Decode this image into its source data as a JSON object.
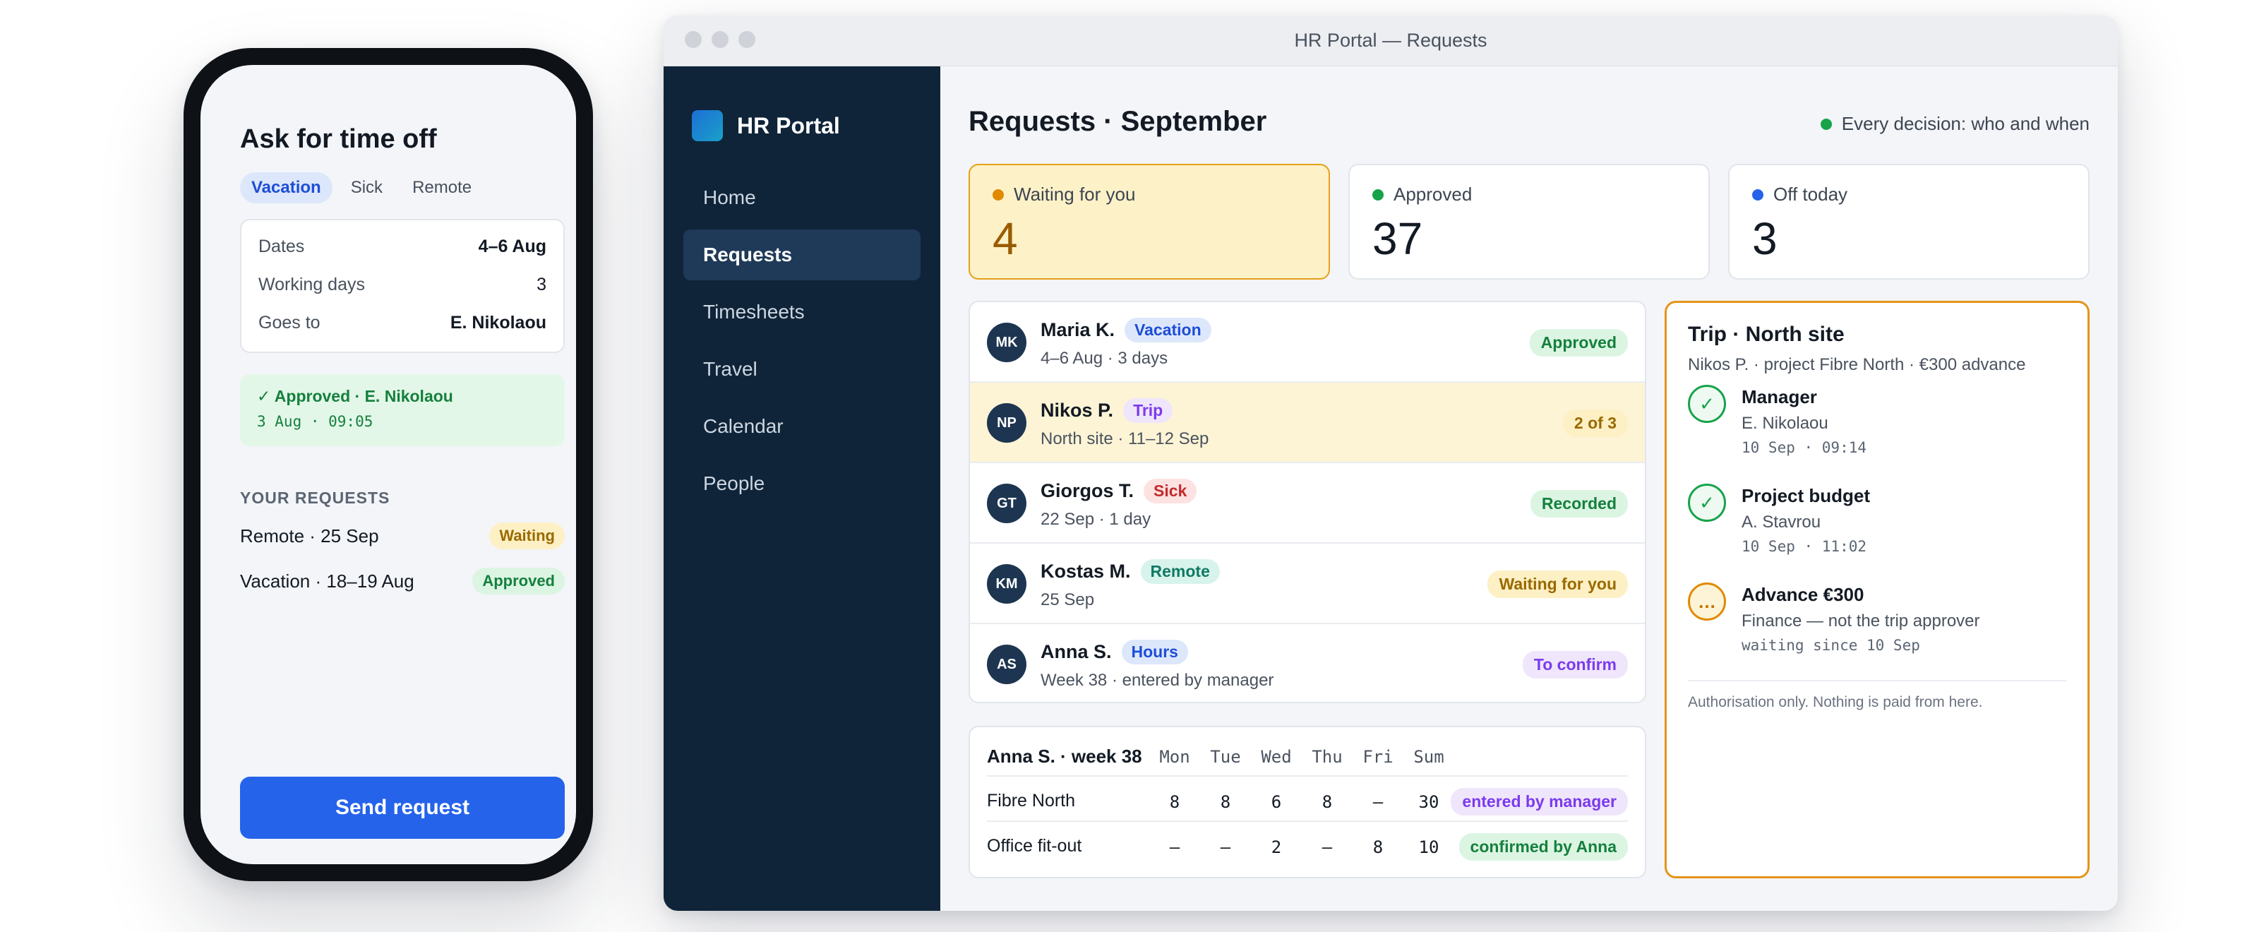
{
  "phone": {
    "title": "Ask for time off",
    "tabs": [
      {
        "label": "Vacation",
        "active": true
      },
      {
        "label": "Sick",
        "active": false
      },
      {
        "label": "Remote",
        "active": false
      }
    ],
    "form": {
      "dates_label": "Dates",
      "dates_value": "4–6 Aug",
      "days_label": "Working days",
      "days_value": "3",
      "goes_label": "Goes to",
      "goes_value": "E. Nikolaou"
    },
    "approval": {
      "line1": "✓ Approved · E. Nikolaou",
      "line2": "3 Aug · 09:05"
    },
    "section_title": "YOUR REQUESTS",
    "requests": [
      {
        "label": "Remote · 25 Sep",
        "status": "Waiting"
      },
      {
        "label": "Vacation · 18–19 Aug",
        "status": "Approved"
      }
    ],
    "send_label": "Send request"
  },
  "window": {
    "title": "HR Portal — Requests",
    "brand": "HR Portal",
    "nav": [
      {
        "label": "Home",
        "active": false
      },
      {
        "label": "Requests",
        "active": true
      },
      {
        "label": "Timesheets",
        "active": false
      },
      {
        "label": "Travel",
        "active": false
      },
      {
        "label": "Calendar",
        "active": false
      },
      {
        "label": "People",
        "active": false
      }
    ],
    "page_title": "Requests · September",
    "audit_note": "Every decision: who and when",
    "stats": [
      {
        "label": "Waiting for you",
        "value": "4",
        "color": "#e08a00"
      },
      {
        "label": "Approved",
        "value": "37",
        "color": "#16a34a"
      },
      {
        "label": "Off today",
        "value": "3",
        "color": "#2563eb"
      }
    ],
    "requests": [
      {
        "initials": "MK",
        "name": "Maria K.",
        "type": "Vacation",
        "sub": "4–6 Aug · 3 days",
        "status": "Approved"
      },
      {
        "initials": "NP",
        "name": "Nikos P.",
        "type": "Trip",
        "sub": "North site · 11–12 Sep",
        "status": "2 of 3"
      },
      {
        "initials": "GT",
        "name": "Giorgos T.",
        "type": "Sick",
        "sub": "22 Sep · 1 day",
        "status": "Recorded"
      },
      {
        "initials": "KM",
        "name": "Kostas M.",
        "type": "Remote",
        "sub": "25 Sep",
        "status": "Waiting for you"
      },
      {
        "initials": "AS",
        "name": "Anna S.",
        "type": "Hours",
        "sub": "Week 38 · entered by manager",
        "status": "To confirm"
      }
    ],
    "timesheet": {
      "title": "Anna S. · week 38",
      "days": [
        "Mon",
        "Tue",
        "Wed",
        "Thu",
        "Fri",
        "Sum"
      ],
      "rows": [
        {
          "project": "Fibre North",
          "hours": [
            "8",
            "8",
            "6",
            "8",
            "–",
            "30"
          ],
          "note": "entered by manager"
        },
        {
          "project": "Office fit-out",
          "hours": [
            "–",
            "–",
            "2",
            "–",
            "8",
            "10"
          ],
          "note": "confirmed by Anna"
        }
      ]
    },
    "detail": {
      "title": "Trip · North site",
      "subtitle": "Nikos P. · project Fibre North · €300 advance",
      "steps": [
        {
          "icon": "✓",
          "role": "Manager",
          "who": "E. Nikolaou",
          "when": "10 Sep · 09:14"
        },
        {
          "icon": "✓",
          "role": "Project budget",
          "who": "A. Stavrou",
          "when": "10 Sep · 11:02"
        },
        {
          "icon": "…",
          "role": "Advance €300",
          "who": "Finance — not the trip approver",
          "when": "waiting since 10 Sep"
        }
      ],
      "footer": "Authorisation only. Nothing is paid from here."
    }
  }
}
